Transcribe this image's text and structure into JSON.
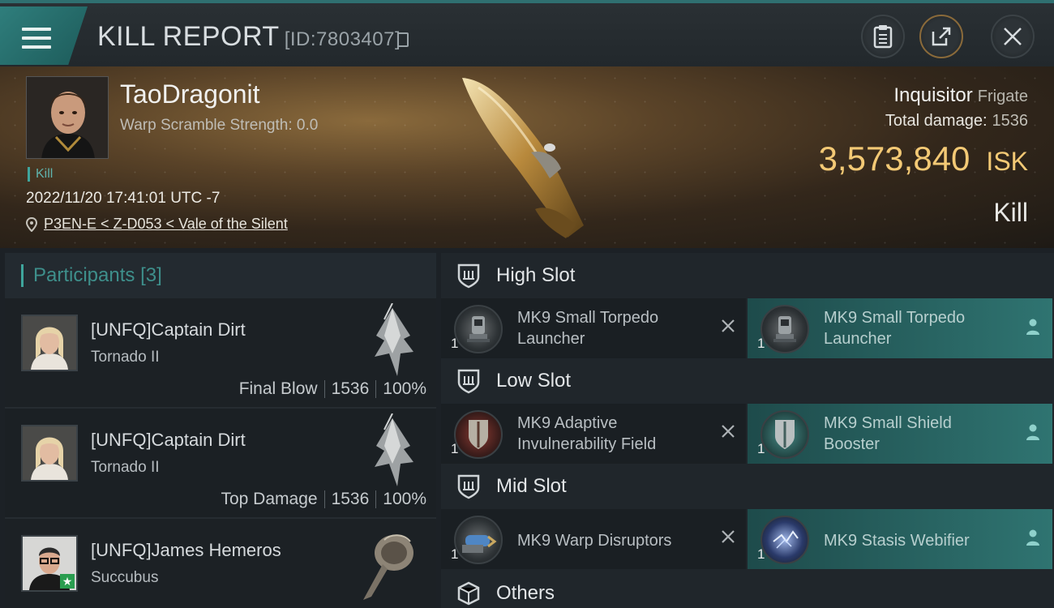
{
  "header": {
    "title": "KILL REPORT",
    "report_id": "[ID:7803407]"
  },
  "victim": {
    "name": "TaoDragonit",
    "warp_scramble": "Warp Scramble Strength: 0.0",
    "kill_badge": "Kill",
    "date": "2022/11/20 17:41:01 UTC -7",
    "location": "P3EN-E < Z-D053 < Vale of the Silent",
    "ship_name": "Inquisitor",
    "ship_class": "Frigate",
    "total_damage_label": "Total damage:",
    "total_damage_value": "1536",
    "isk_value": "3,573,840",
    "isk_unit": "ISK",
    "result": "Kill"
  },
  "participants": {
    "label": "Participants",
    "count": "[3]",
    "rows": [
      {
        "name": "[UNFQ]Captain Dirt",
        "ship": "Tornado II",
        "role": "Final Blow",
        "damage": "1536",
        "percent": "100%"
      },
      {
        "name": "[UNFQ]Captain Dirt",
        "ship": "Tornado II",
        "role": "Top Damage",
        "damage": "1536",
        "percent": "100%"
      },
      {
        "name": "[UNFQ]James Hemeros",
        "ship": "Succubus"
      }
    ]
  },
  "slots": {
    "high": {
      "label": "High Slot",
      "destroyed": {
        "name": "MK9 Small Torpedo Launcher",
        "qty": "1"
      },
      "dropped": {
        "name": "MK9 Small Torpedo Launcher",
        "qty": "1"
      }
    },
    "low": {
      "label": "Low Slot",
      "destroyed": {
        "name": "MK9 Adaptive Invulnerability Field",
        "qty": "1"
      },
      "dropped": {
        "name": "MK9 Small Shield Booster",
        "qty": "1"
      }
    },
    "mid": {
      "label": "Mid Slot",
      "destroyed": {
        "name": "MK9 Warp Disruptors",
        "qty": "1"
      },
      "dropped": {
        "name": "MK9 Stasis Webifier",
        "qty": "1"
      }
    },
    "others": {
      "label": "Others"
    }
  },
  "colors": {
    "accent_teal": "#3fa59c",
    "isk_gold": "#f3c975",
    "dropped_bg": "#2f7471"
  }
}
